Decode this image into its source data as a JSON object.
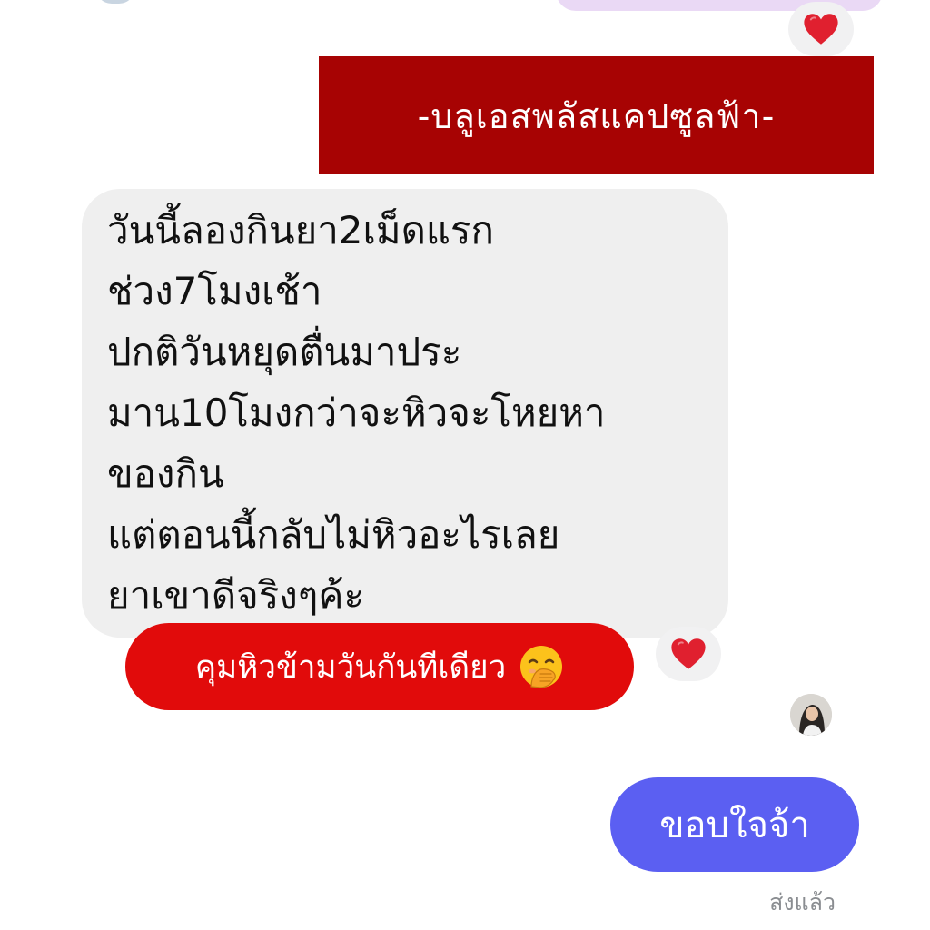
{
  "banner": {
    "text": "-บลูเอสพลัสแคปซูลฟ้า-"
  },
  "received_message": {
    "lines": [
      "วันนี้ลองกินยา2เม็ดแรก",
      "ช่วง7โมงเช้า",
      "ปกติวันหยุดตื่นมาประ",
      "มาน10โมงกว่าจะหิวจะโหยหา",
      "ของกิน",
      "แต่ตอนนี้กลับไม่หิวอะไรเลย",
      "ยาเขาดีจริงๆค้ะ"
    ]
  },
  "caption": {
    "text": "คุมหิวข้ามวันกันทีเดียว",
    "emoji": "face-with-hand-over-mouth-icon"
  },
  "reactions": {
    "top": "heart-icon",
    "middle": "heart-icon"
  },
  "sent_message": {
    "text": "ขอบใจจ้า"
  },
  "message_status": "ส่งแล้ว",
  "colors": {
    "banner_bg": "#a70303",
    "caption_bg": "#e10b0b",
    "received_bubble_bg": "#efefef",
    "sent_bubble_bg": "#5b5ff2",
    "heart": "#e0202f",
    "status_text": "#8a8d91"
  }
}
